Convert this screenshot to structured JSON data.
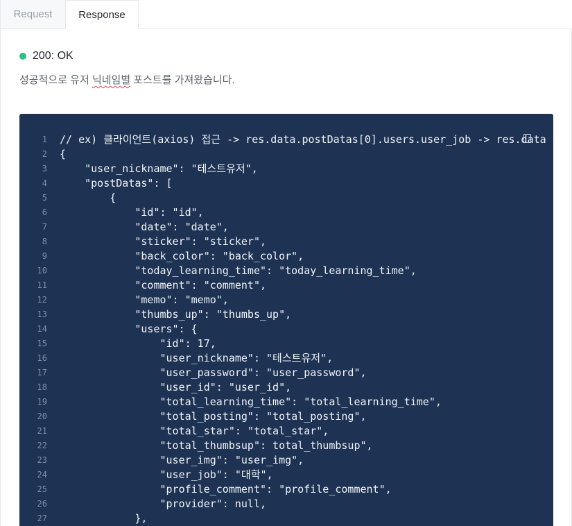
{
  "tabs": [
    {
      "label": "Request",
      "active": false
    },
    {
      "label": "Response",
      "active": true
    }
  ],
  "status": {
    "text": "200: OK",
    "color": "#2ec27e"
  },
  "description": {
    "before": "성공적으로 유저 ",
    "marked": "닉네임별",
    "after": " 포스트를 가져왔습니다."
  },
  "code": {
    "background": "#1e3354",
    "copy_icon": "copy-icon",
    "lines": [
      {
        "n": "1",
        "text": "// ex) 클라이언트(axios) 접근 -> res.data.postDatas[0].users.user_job -> res.data"
      },
      {
        "n": "2",
        "text": "{"
      },
      {
        "n": "3",
        "text": "    \"user_nickname\": \"테스트유저\","
      },
      {
        "n": "4",
        "text": "    \"postDatas\": ["
      },
      {
        "n": "5",
        "text": "        {"
      },
      {
        "n": "6",
        "text": "            \"id\": \"id\","
      },
      {
        "n": "7",
        "text": "            \"date\": \"date\","
      },
      {
        "n": "8",
        "text": "            \"sticker\": \"sticker\","
      },
      {
        "n": "9",
        "text": "            \"back_color\": \"back_color\","
      },
      {
        "n": "10",
        "text": "            \"today_learning_time\": \"today_learning_time\","
      },
      {
        "n": "11",
        "text": "            \"comment\": \"comment\","
      },
      {
        "n": "12",
        "text": "            \"memo\": \"memo\","
      },
      {
        "n": "13",
        "text": "            \"thumbs_up\": \"thumbs_up\","
      },
      {
        "n": "14",
        "text": "            \"users\": {"
      },
      {
        "n": "15",
        "text": "                \"id\": 17,"
      },
      {
        "n": "16",
        "text": "                \"user_nickname\": \"테스트유저\","
      },
      {
        "n": "17",
        "text": "                \"user_password\": \"user_password\","
      },
      {
        "n": "18",
        "text": "                \"user_id\": \"user_id\","
      },
      {
        "n": "19",
        "text": "                \"total_learning_time\": \"total_learning_time\","
      },
      {
        "n": "20",
        "text": "                \"total_posting\": \"total_posting\","
      },
      {
        "n": "21",
        "text": "                \"total_star\": \"total_star\","
      },
      {
        "n": "22",
        "text": "                \"total_thumbsup\": total_thumbsup\","
      },
      {
        "n": "23",
        "text": "                \"user_img\": \"user_img\","
      },
      {
        "n": "24",
        "text": "                \"user_job\": \"대학\","
      },
      {
        "n": "25",
        "text": "                \"profile_comment\": \"profile_comment\","
      },
      {
        "n": "26",
        "text": "                \"provider\": null,"
      },
      {
        "n": "27",
        "text": "            },"
      }
    ]
  }
}
